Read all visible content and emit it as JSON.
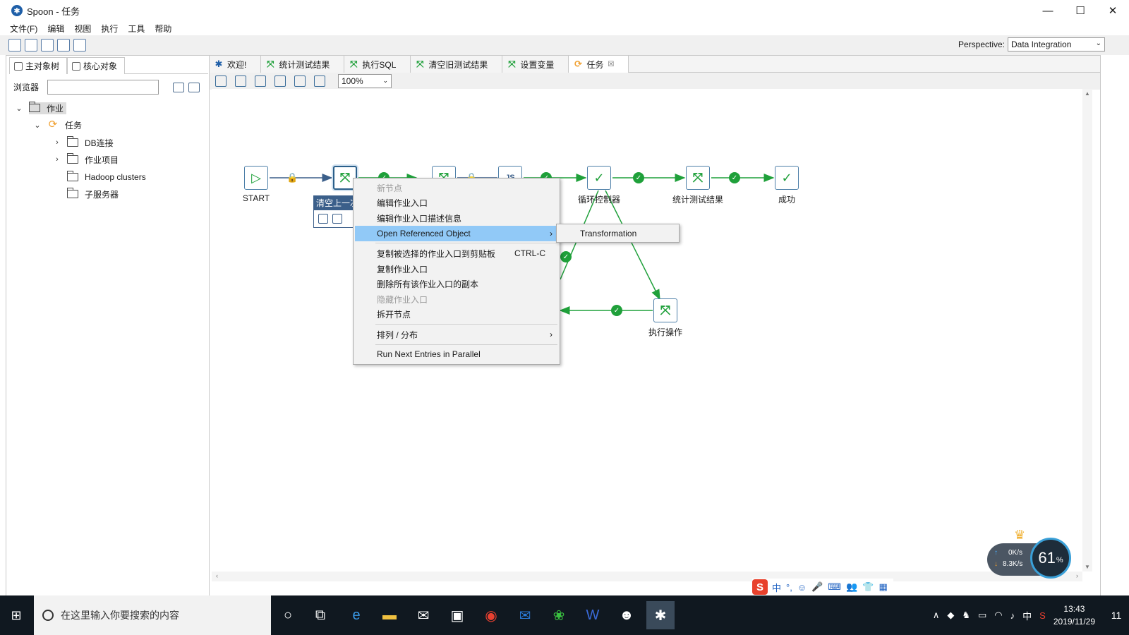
{
  "window": {
    "title": "Spoon - 任务",
    "minimize": "—",
    "maximize": "☐",
    "close": "✕"
  },
  "menu": [
    "文件(F)",
    "编辑",
    "视图",
    "执行",
    "工具",
    "帮助"
  ],
  "perspective": {
    "label": "Perspective:",
    "value": "Data Integration"
  },
  "left_panel": {
    "tabs": [
      "主对象树",
      "核心对象"
    ],
    "browser_label": "浏览器",
    "search_value": "",
    "tree": [
      {
        "label": "作业",
        "level": 0,
        "expanded": true,
        "type": "folder",
        "selected": true
      },
      {
        "label": "任务",
        "level": 1,
        "expanded": true,
        "type": "job"
      },
      {
        "label": "DB连接",
        "level": 2,
        "expanded": false,
        "type": "folder"
      },
      {
        "label": "作业项目",
        "level": 2,
        "expanded": false,
        "type": "folder"
      },
      {
        "label": "Hadoop clusters",
        "level": 2,
        "type": "folder"
      },
      {
        "label": "子服务器",
        "level": 2,
        "type": "folder"
      }
    ]
  },
  "editor": {
    "tabs": [
      {
        "label": "欢迎!",
        "icon": "spoon-icon"
      },
      {
        "label": "统计测试结果",
        "icon": "transformation-icon"
      },
      {
        "label": "执行SQL",
        "icon": "transformation-icon"
      },
      {
        "label": "清空旧测试结果",
        "icon": "transformation-icon"
      },
      {
        "label": "设置变量",
        "icon": "transformation-icon"
      },
      {
        "label": "任务",
        "icon": "job-icon",
        "active": true,
        "closable": true
      }
    ],
    "zoom": "100%"
  },
  "canvas": {
    "nodes": [
      {
        "id": "start",
        "label": "START",
        "glyph": "▷"
      },
      {
        "id": "clear",
        "label": "",
        "glyph": "⤧"
      },
      {
        "id": "n3",
        "label": "",
        "glyph": "⤧"
      },
      {
        "id": "n4",
        "label": "",
        "glyph": "JS"
      },
      {
        "id": "loop",
        "label": "循环控制器",
        "glyph": "✓"
      },
      {
        "id": "stats",
        "label": "统计测试结果",
        "glyph": "⤧"
      },
      {
        "id": "success",
        "label": "成功",
        "glyph": "✓"
      },
      {
        "id": "exec",
        "label": "执行操作",
        "glyph": "⤧"
      }
    ],
    "tooltip": "清空上一次"
  },
  "context_menu": {
    "items": [
      {
        "label": "新节点",
        "disabled": true
      },
      {
        "label": "编辑作业入口"
      },
      {
        "label": "编辑作业入口描述信息"
      },
      {
        "label": "Open Referenced Object",
        "highlighted": true,
        "submenu": true
      },
      {
        "label": "复制被选择的作业入口到剪贴板",
        "shortcut": "CTRL-C"
      },
      {
        "label": "复制作业入口"
      },
      {
        "label": "删除所有该作业入口的副本"
      },
      {
        "label": "隐藏作业入口",
        "disabled": true
      },
      {
        "label": "拆开节点"
      },
      {
        "label": "排列 / 分布",
        "submenu": true
      },
      {
        "label": "Run Next Entries in Parallel"
      }
    ],
    "submenu_item": "Transformation"
  },
  "net_monitor": {
    "up": "0K/s",
    "down": "8.3K/s",
    "percent": "61",
    "unit": "%"
  },
  "ime": {
    "items": [
      "中",
      "°,",
      "☺",
      "🎤",
      "⌨",
      "👥",
      "👕",
      "▦"
    ]
  },
  "taskbar": {
    "search_placeholder": "在这里输入你要搜索的内容",
    "time": "13:43",
    "date": "2019/11/29",
    "tray_lang": "中",
    "notification_count": "11"
  }
}
